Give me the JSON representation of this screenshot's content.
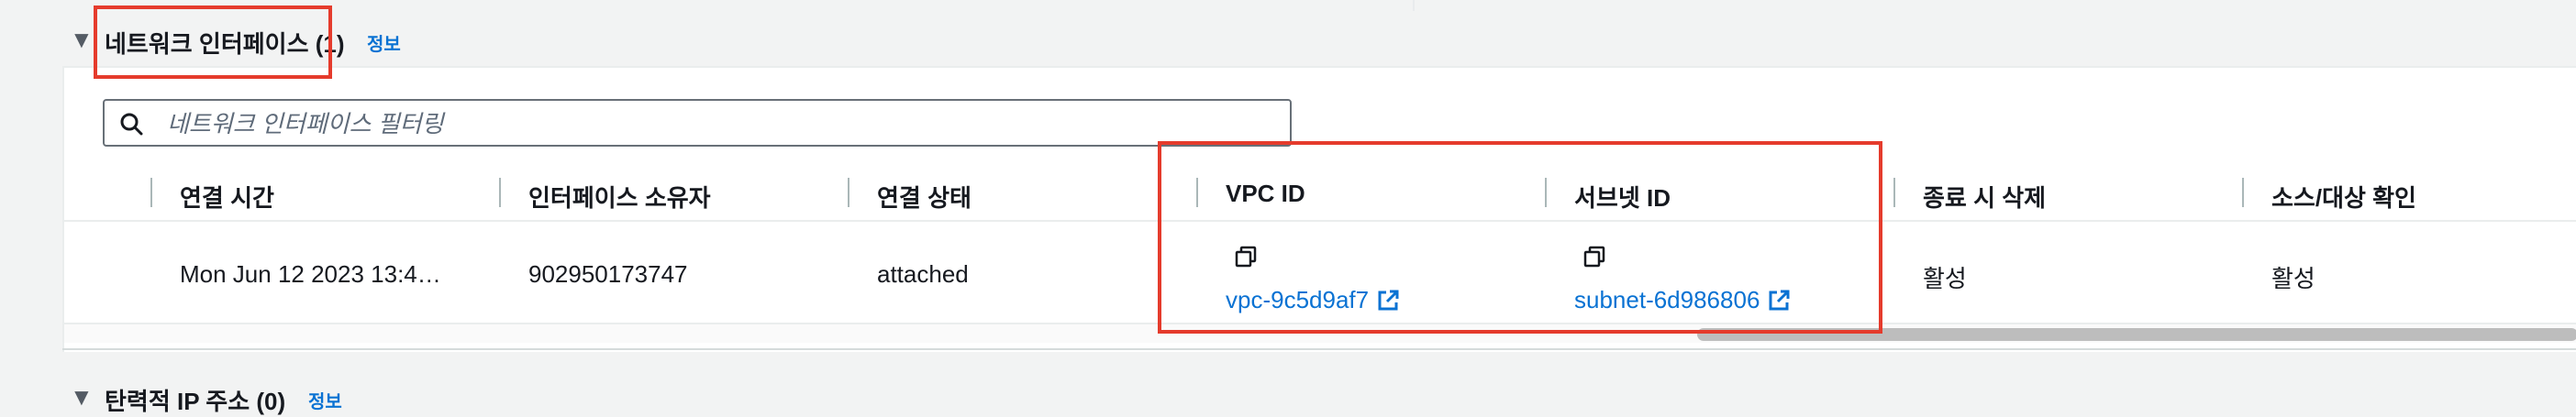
{
  "network_section": {
    "title": "네트워크 인터페이스 (1)",
    "info_link": "정보",
    "filter_placeholder": "네트워크 인터페이스 필터링",
    "columns": [
      "연결 시간",
      "인터페이스 소유자",
      "연결 상태",
      "VPC ID",
      "서브넷 ID",
      "종료 시 삭제",
      "소스/대상 확인"
    ],
    "row": {
      "attach_time": "Mon Jun 12 2023 13:4…",
      "owner": "902950173747",
      "status": "attached",
      "vpc_id": "vpc-9c5d9af7",
      "subnet_id": "subnet-6d986806",
      "delete_on_termination": "활성",
      "source_dest_check": "활성"
    }
  },
  "elastic_ip_section": {
    "title": "탄력적 IP 주소 (0)",
    "info_link": "정보"
  },
  "icons": {
    "caret": "caret-down-icon",
    "search": "search-icon",
    "copy": "copy-icon",
    "external": "external-link-icon"
  },
  "colors": {
    "link": "#0972d3",
    "highlight_box": "#e53b2c",
    "background": "#f2f3f3"
  }
}
